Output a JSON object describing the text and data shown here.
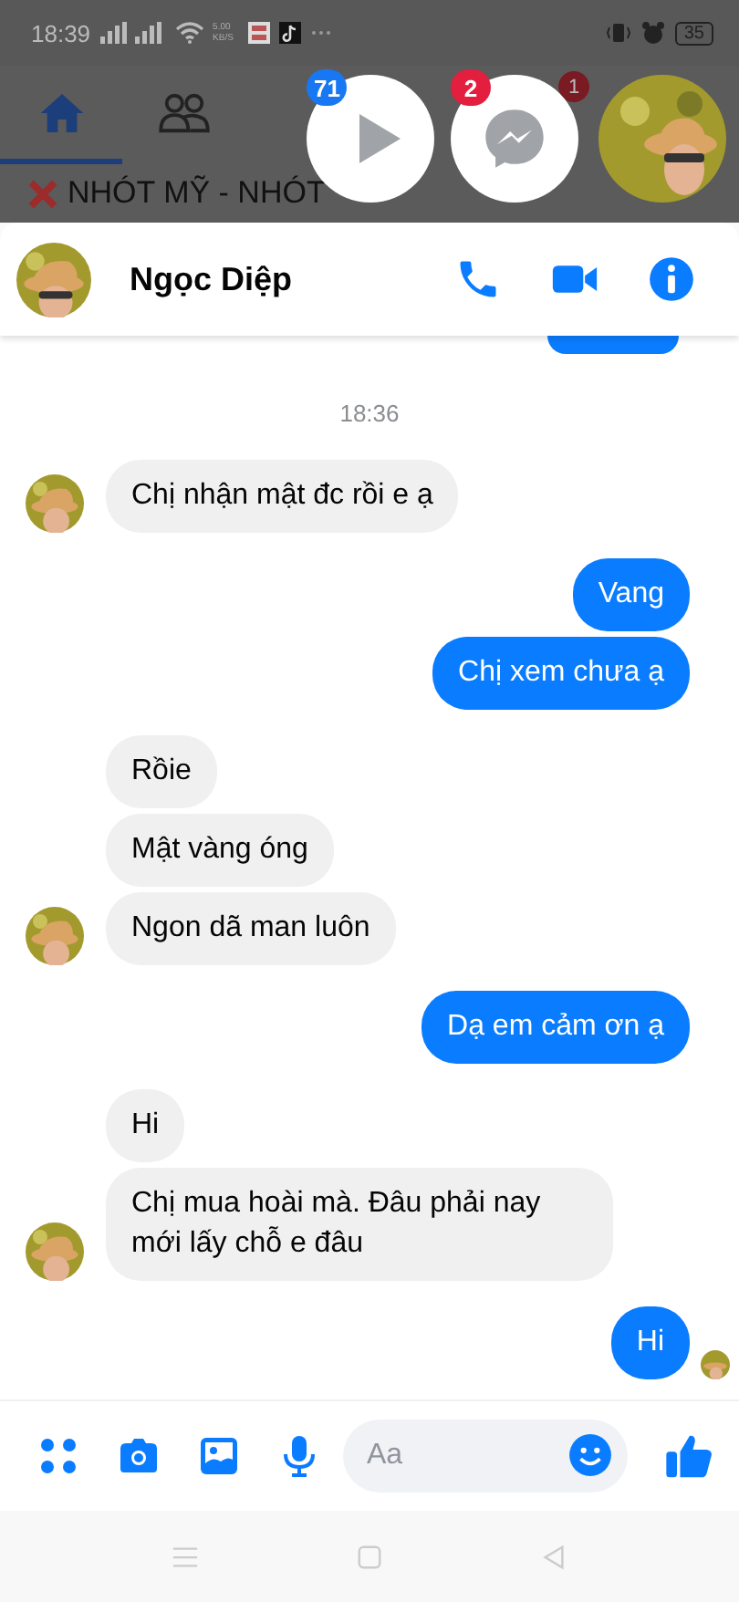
{
  "status_bar": {
    "time": "18:39",
    "speed": "5.00 KB/S",
    "battery": "35"
  },
  "background": {
    "tabs": [
      {
        "selected": true
      },
      {
        "selected": false
      }
    ],
    "post_texts": [
      "NHÓT MỸ - NHÓT"
    ],
    "tab_badge": "1"
  },
  "chat_heads": [
    {
      "kind": "video",
      "badge": "71",
      "color": "#1877f2"
    },
    {
      "kind": "messenger",
      "badge": "2",
      "color": "#e41e3f"
    },
    {
      "kind": "avatar"
    }
  ],
  "chat": {
    "contact_name": "Ngọc Diệp",
    "timestamp": "18:36",
    "messages": [
      {
        "kind": "incoming",
        "text": "Chị nhận mật đc rồi e ạ",
        "avatar": true
      },
      {
        "kind": "outgoing",
        "text": "Vang",
        "seen": false
      },
      {
        "kind": "outgoing",
        "text": "Chị xem chưa ạ",
        "seen": false
      },
      {
        "kind": "incoming",
        "text": "Rồie",
        "avatar": false
      },
      {
        "kind": "incoming",
        "text": "Mật vàng óng",
        "avatar": false
      },
      {
        "kind": "incoming",
        "text": "Ngon dã man luôn",
        "avatar": true
      },
      {
        "kind": "outgoing",
        "text": "Dạ em cảm ơn ạ",
        "seen": false
      },
      {
        "kind": "incoming",
        "text": "Hi",
        "avatar": false
      },
      {
        "kind": "incoming",
        "text": "Chị mua hoài mà. Đâu phải nay mới lấy chỗ e đâu",
        "avatar": true
      },
      {
        "kind": "outgoing",
        "text": "Hi",
        "seen": true
      }
    ]
  },
  "composer": {
    "placeholder": "Aa"
  }
}
